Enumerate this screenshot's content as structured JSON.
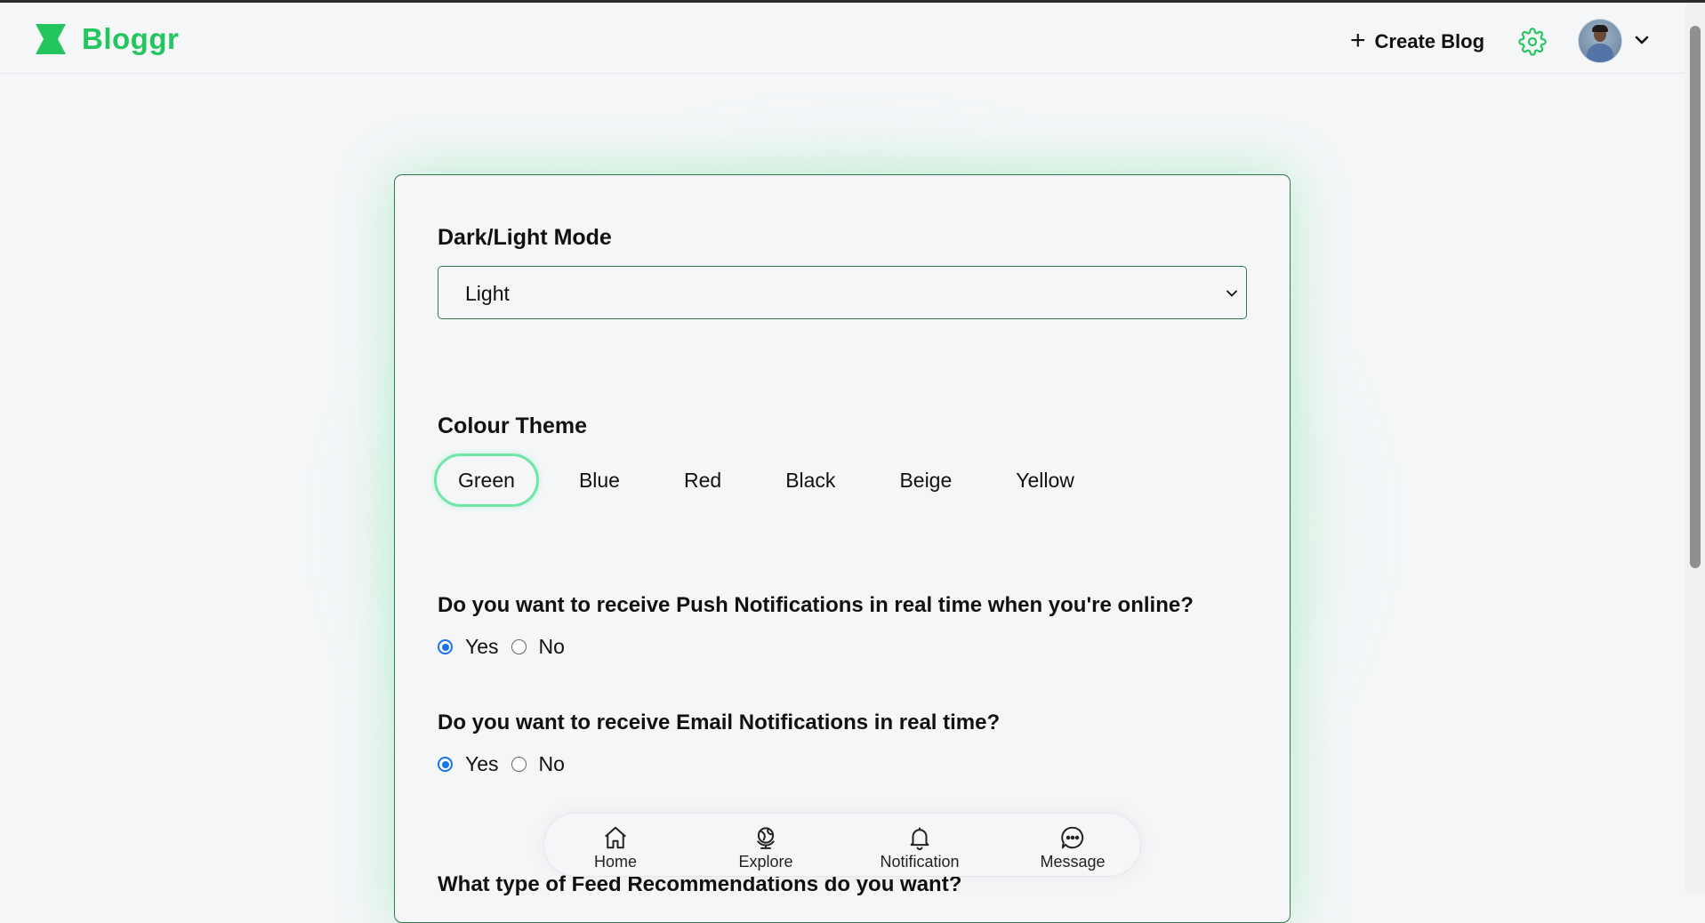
{
  "app": {
    "name": "Bloggr",
    "brand_color": "#22c55e"
  },
  "header": {
    "create_blog_label": "Create Blog",
    "icons": [
      "logo-icon",
      "plus-icon",
      "gear-icon",
      "avatar",
      "chevron-down-icon"
    ]
  },
  "settings": {
    "mode": {
      "label": "Dark/Light Mode",
      "selected": "Light"
    },
    "colour_theme": {
      "label": "Colour Theme",
      "options": [
        "Green",
        "Blue",
        "Red",
        "Black",
        "Beige",
        "Yellow"
      ],
      "selected": "Green"
    },
    "push": {
      "question": "Do you want to receive Push Notifications in real time when you're online?",
      "yes_label": "Yes",
      "no_label": "No",
      "selected": "Yes"
    },
    "email": {
      "question": "Do you want to receive Email Notifications in real time?",
      "yes_label": "Yes",
      "no_label": "No",
      "selected": "Yes"
    },
    "feed": {
      "question": "What type of Feed Recommendations do you want?"
    }
  },
  "bottom_nav": {
    "items": [
      {
        "label": "Home",
        "icon": "home-icon"
      },
      {
        "label": "Explore",
        "icon": "globe-icon"
      },
      {
        "label": "Notification",
        "icon": "bell-icon"
      },
      {
        "label": "Message",
        "icon": "message-icon"
      }
    ]
  },
  "colors": {
    "accent": "#22c55e",
    "card_border": "#2f7a4f",
    "radio_checked": "#1a73e8",
    "theme_active_ring": "#6ee7a8"
  }
}
